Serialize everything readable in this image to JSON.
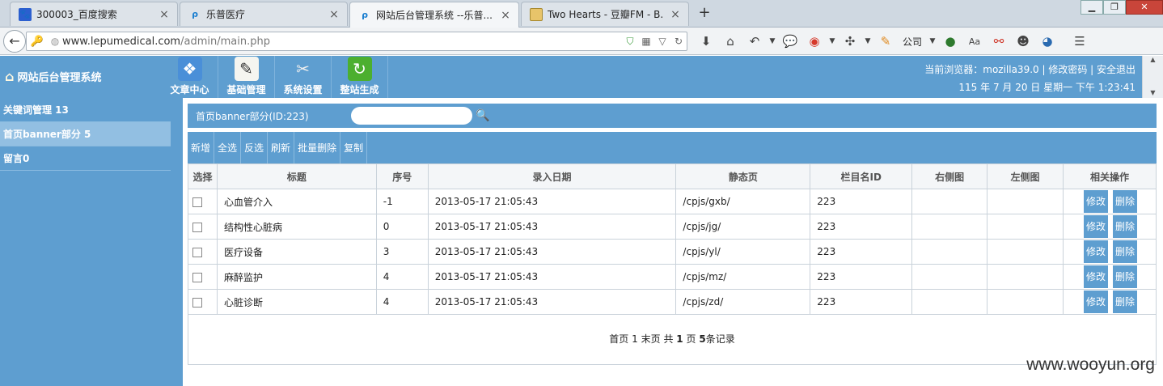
{
  "browser": {
    "tabs": [
      {
        "label": "300003_百度搜索",
        "icon": "baidu-paw-icon",
        "active": false
      },
      {
        "label": "乐普医疗",
        "icon": "lepu-logo-icon",
        "active": false
      },
      {
        "label": "网站后台管理系统 --乐普...",
        "icon": "lepu-logo-icon",
        "active": true
      },
      {
        "label": "Two Hearts - 豆瓣FM - B...",
        "icon": "douban-fm-icon",
        "active": false
      }
    ],
    "url_host": "www.lepumedical.com",
    "url_path": "/admin/main.php",
    "toolbar_company": "公司"
  },
  "header": {
    "system_title": "网站后台管理系统",
    "nav": [
      {
        "label": "文章中心",
        "icon": "article-center-icon"
      },
      {
        "label": "基础管理",
        "icon": "basic-management-icon"
      },
      {
        "label": "系统设置",
        "icon": "system-settings-icon"
      },
      {
        "label": "整站生成",
        "icon": "site-generate-icon"
      }
    ],
    "browser_info": "当前浏览器：mozilla39.0 | 修改密码 | 安全退出",
    "datetime": "115 年 7 月 20 日 星期一 下午 1:23:41"
  },
  "sidebar": {
    "items": [
      {
        "label": "关键词管理 13",
        "active": false
      },
      {
        "label": "首页banner部分 5",
        "active": true
      },
      {
        "label": "留言0",
        "active": false
      }
    ]
  },
  "main": {
    "section_title": "首页banner部分(ID:223)",
    "search_value": "",
    "toolbar": [
      "新增",
      "全选",
      "反选",
      "刷新",
      "批量删除",
      "复制"
    ],
    "columns": [
      "选择",
      "标题",
      "序号",
      "录入日期",
      "静态页",
      "栏目名ID",
      "右侧图",
      "左侧图",
      "相关操作"
    ],
    "rows": [
      {
        "title": "心血管介入",
        "order": "-1",
        "date": "2013-05-17 21:05:43",
        "static_page": "/cpjs/gxb/",
        "column_id": "223",
        "right_img": "",
        "left_img": ""
      },
      {
        "title": "结构性心脏病",
        "order": "0",
        "date": "2013-05-17 21:05:43",
        "static_page": "/cpjs/jg/",
        "column_id": "223",
        "right_img": "",
        "left_img": ""
      },
      {
        "title": "医疗设备",
        "order": "3",
        "date": "2013-05-17 21:05:43",
        "static_page": "/cpjs/yl/",
        "column_id": "223",
        "right_img": "",
        "left_img": ""
      },
      {
        "title": "麻醉监护",
        "order": "4",
        "date": "2013-05-17 21:05:43",
        "static_page": "/cpjs/mz/",
        "column_id": "223",
        "right_img": "",
        "left_img": ""
      },
      {
        "title": "心脏诊断",
        "order": "4",
        "date": "2013-05-17 21:05:43",
        "static_page": "/cpjs/zd/",
        "column_id": "223",
        "right_img": "",
        "left_img": ""
      }
    ],
    "row_actions": {
      "edit": "修改",
      "delete": "删除"
    },
    "pager": {
      "first": "首页",
      "current": "1",
      "last": "末页",
      "total_prefix": "共",
      "total_pages": "1",
      "pages_word": "页",
      "total_records": "5",
      "records_word": "条记录"
    }
  },
  "watermark": "www.wooyun.org",
  "colors": {
    "accent": "#5e9ed0",
    "sidebar_active": "#92bfe2"
  }
}
